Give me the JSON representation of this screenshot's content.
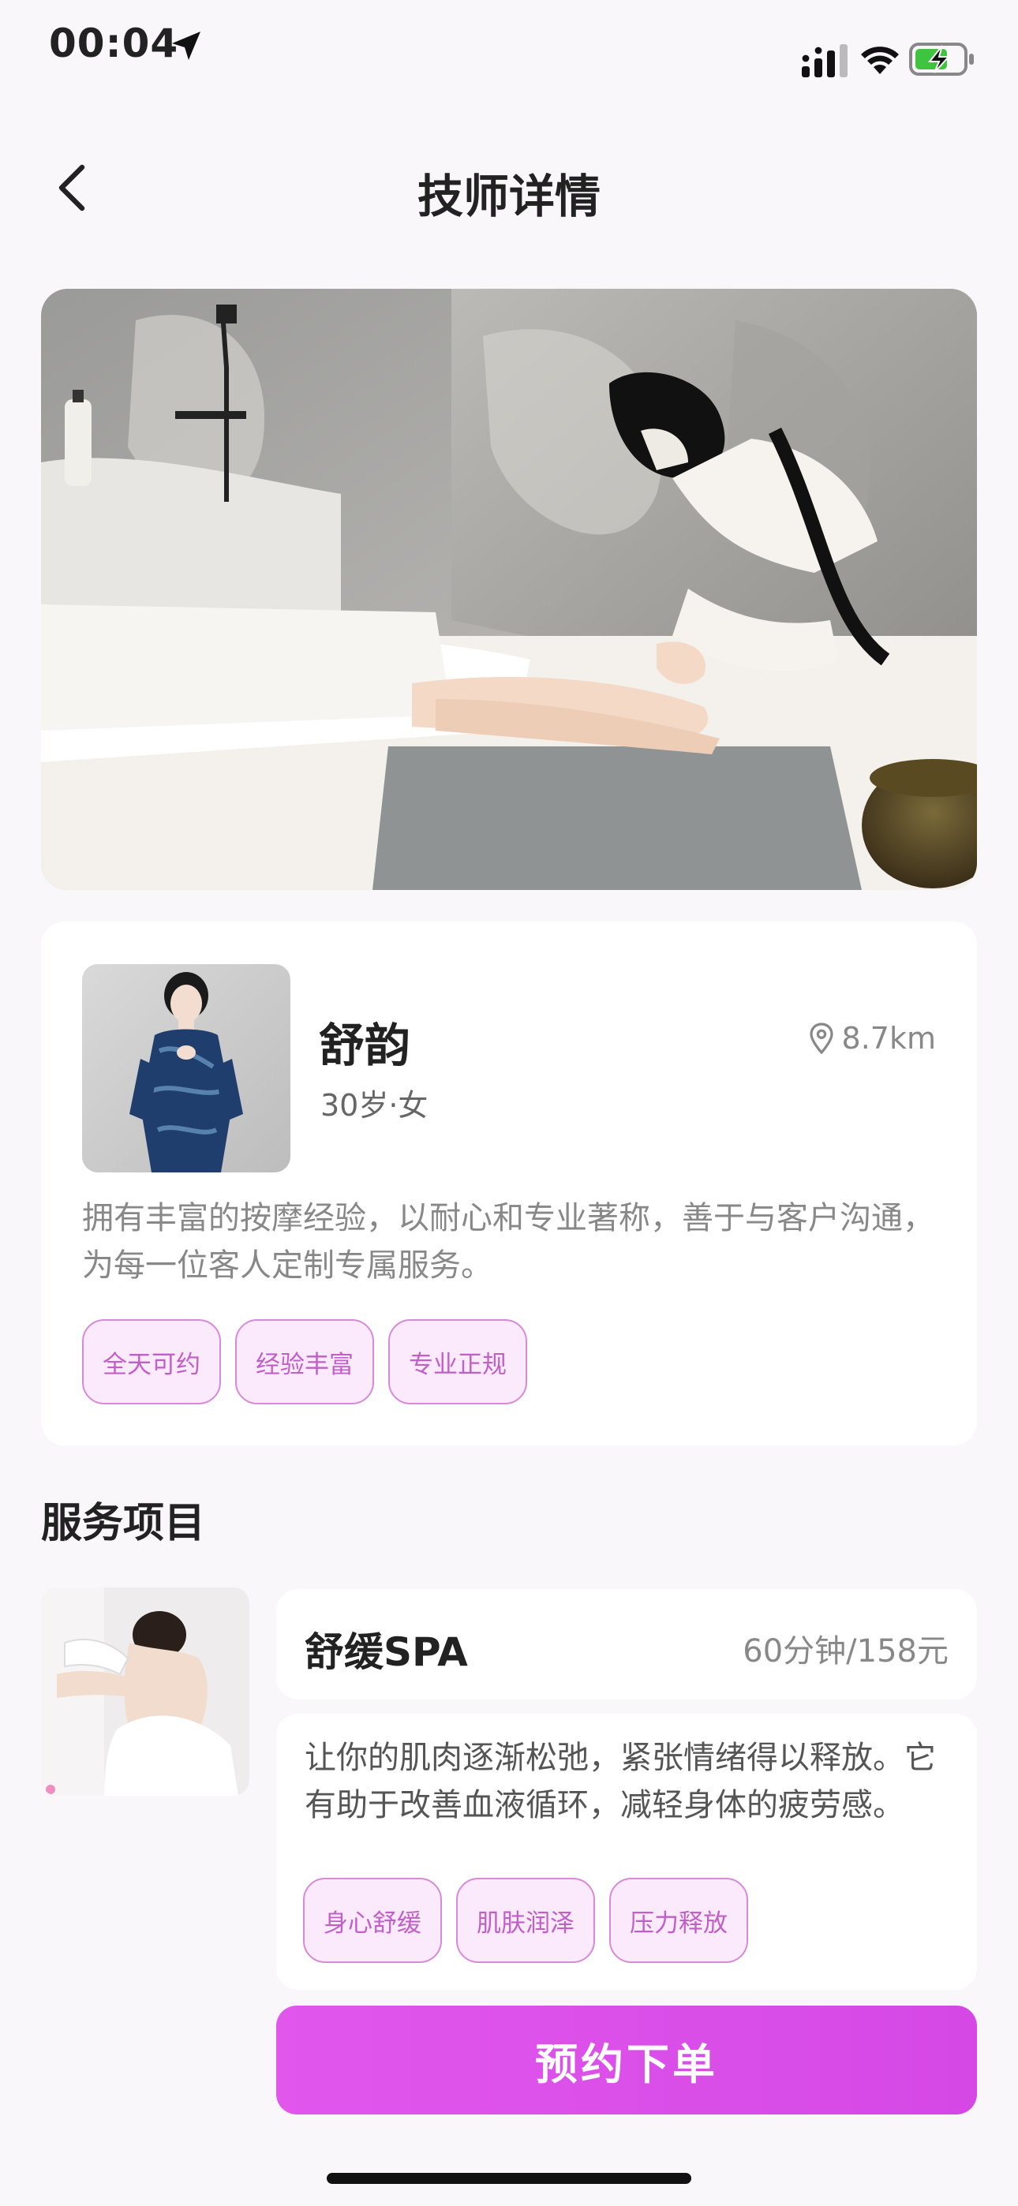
{
  "status_bar": {
    "time": "00:04",
    "icons": [
      "location-arrow-icon",
      "cellular-signal-icon",
      "wifi-icon",
      "battery-charging-icon"
    ]
  },
  "nav": {
    "back_icon": "chevron-left-icon",
    "title": "技师详情"
  },
  "technician": {
    "name": "舒韵",
    "meta": "30岁·女",
    "distance": "8.7km",
    "description": "拥有丰富的按摩经验，以耐心和专业著称，善于与客户沟通，为每一位客人定制专属服务。",
    "tags": [
      "全天可约",
      "经验丰富",
      "专业正规"
    ]
  },
  "services_section": {
    "title": "服务项目"
  },
  "service": {
    "name": "舒缓SPA",
    "price": "60分钟/158元",
    "description": "让你的肌肉逐渐松弛，紧张情绪得以释放。它有助于改善血液循环，减轻身体的疲劳感。",
    "tags": [
      "身心舒缓",
      "肌肤润泽",
      "压力释放"
    ]
  },
  "cta": {
    "label": "预约下单"
  },
  "colors": {
    "accent": "#d84ee8",
    "tag_border": "#d88ad8",
    "tag_bg": "#fbe9fc",
    "tag_text": "#c060c6",
    "page_bg": "#faf7fb"
  }
}
